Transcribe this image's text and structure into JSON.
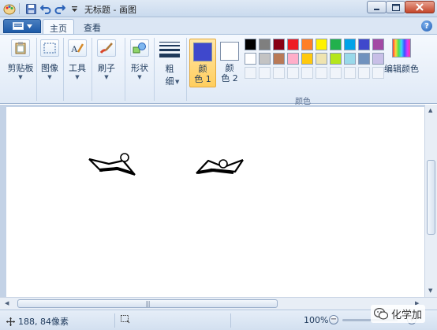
{
  "window": {
    "title": "无标题 - 画图",
    "minimize_icon": "minimize-icon",
    "maximize_icon": "maximize-icon",
    "close_icon": "close-icon"
  },
  "quick_access": [
    "save-icon",
    "undo-icon",
    "redo-icon",
    "customize-dropdown-icon"
  ],
  "tabs": [
    {
      "label": "主页",
      "active": true
    },
    {
      "label": "查看",
      "active": false
    }
  ],
  "ribbon": {
    "clipboard": {
      "label": "剪贴板",
      "icon": "clipboard-icon"
    },
    "image": {
      "label": "图像",
      "icon": "select-icon"
    },
    "tools": {
      "label": "工具",
      "icon": "tools-icon"
    },
    "brushes": {
      "label": "刷子",
      "icon": "brush-icon"
    },
    "shapes": {
      "label": "形状",
      "icon": "shapes-icon"
    },
    "size": {
      "label_1": "粗",
      "label_2": "细",
      "icon": "line-width-icon"
    },
    "color1": {
      "label_1": "颜",
      "label_2": "色 1",
      "color": "#3f48cc"
    },
    "color2": {
      "label_1": "颜",
      "label_2": "色 2",
      "color": "#ffffff"
    },
    "palette_row1": [
      "#000000",
      "#7f7f7f",
      "#880015",
      "#ed1c24",
      "#ff7f27",
      "#fff200",
      "#22b14c",
      "#00a2e8",
      "#3f48cc",
      "#a349a4"
    ],
    "palette_row2": [
      "#ffffff",
      "#c3c3c3",
      "#b97a57",
      "#ffaec9",
      "#ffc90e",
      "#efe4b0",
      "#b5e61d",
      "#99d9ea",
      "#7092be",
      "#c8bfe7"
    ],
    "palette_row3_count": 10,
    "edit_colors_label": "编辑颜色",
    "colors_group_label": "颜色"
  },
  "status": {
    "cursor_position": "188, 84像素",
    "zoom": "100%",
    "zoom_out": "−",
    "zoom_in": "+"
  },
  "watermark": {
    "text": "化学加",
    "icon": "wechat-icon"
  },
  "colors": {
    "accent_blue": "#1d5aa8",
    "ribbon_bg": "#dfe9f6",
    "canvas_bg": "#c3d2e6"
  }
}
